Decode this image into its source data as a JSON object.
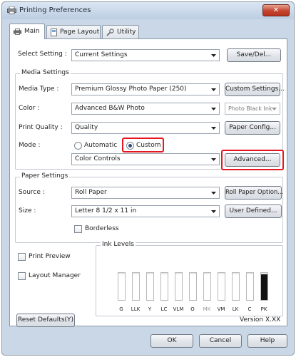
{
  "window": {
    "title": "Printing Preferences",
    "close_label": "✕"
  },
  "tabs": [
    {
      "label": "Main"
    },
    {
      "label": "Page Layout"
    },
    {
      "label": "Utility"
    }
  ],
  "select_setting": {
    "label": "Select Setting :",
    "value": "Current Settings",
    "save_button": "Save/Del..."
  },
  "media_settings": {
    "group_title": "Media Settings",
    "media_type_label": "Media Type :",
    "media_type_value": "Premium Glossy Photo Paper (250)",
    "custom_settings_button": "Custom Settings...",
    "color_label": "Color :",
    "color_value": "Advanced B&W Photo",
    "ink_value": "Photo Black Ink",
    "print_quality_label": "Print Quality :",
    "print_quality_value": "Quality",
    "paper_config_button": "Paper Config...",
    "mode_label": "Mode :",
    "mode_automatic": "Automatic",
    "mode_custom": "Custom",
    "custom_mode_value": "Color Controls",
    "advanced_button": "Advanced..."
  },
  "paper_settings": {
    "group_title": "Paper Settings",
    "source_label": "Source :",
    "source_value": "Roll Paper",
    "roll_option_button": "Roll Paper Option...",
    "size_label": "Size :",
    "size_value": "Letter 8 1/2 x 11 in",
    "user_defined_button": "User Defined...",
    "borderless_label": "Borderless"
  },
  "options": {
    "print_preview": "Print Preview",
    "layout_manager": "Layout Manager"
  },
  "ink_levels": {
    "title": "Ink Levels",
    "inks": [
      {
        "code": "G",
        "color": "#ffffff",
        "level": 0.95
      },
      {
        "code": "LLK",
        "color": "#ffffff",
        "level": 0.95
      },
      {
        "code": "Y",
        "color": "#ffffff",
        "level": 0.95
      },
      {
        "code": "LC",
        "color": "#ffffff",
        "level": 0.95
      },
      {
        "code": "VLM",
        "color": "#ffffff",
        "level": 0.95
      },
      {
        "code": "O",
        "color": "#ffffff",
        "level": 0.95
      },
      {
        "code": "MK",
        "color": "#ffffff",
        "level": 0.95
      },
      {
        "code": "VM",
        "color": "#ffffff",
        "level": 0.95
      },
      {
        "code": "LK",
        "color": "#ffffff",
        "level": 0.95
      },
      {
        "code": "C",
        "color": "#ffffff",
        "level": 0.95
      },
      {
        "code": "PK",
        "color": "#111111",
        "level": 0.95
      }
    ]
  },
  "footer": {
    "reset_button": "Reset Defaults(Y)",
    "version": "Version X.XX",
    "ok": "OK",
    "cancel": "Cancel",
    "help": "Help"
  },
  "colors": {
    "highlight": "#e5161f",
    "panel_bg": "#ffffff",
    "window_bg": "#c9d7e6"
  }
}
